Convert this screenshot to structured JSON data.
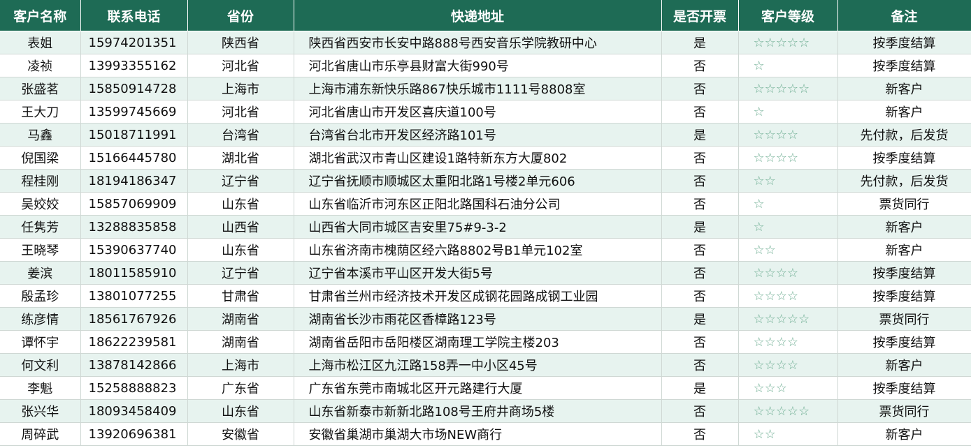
{
  "headers": [
    "客户名称",
    "联系电话",
    "省份",
    "快递地址",
    "是否开票",
    "客户等级",
    "备注"
  ],
  "rows": [
    {
      "name": "表姐",
      "phone": "15974201351",
      "province": "陕西省",
      "address": "陕西省西安市长安中路888号西安音乐学院教研中心",
      "invoice": "是",
      "level": "☆☆☆☆☆",
      "note": "按季度结算"
    },
    {
      "name": "凌祯",
      "phone": "13993355162",
      "province": "河北省",
      "address": "河北省唐山市乐亭县财富大街990号",
      "invoice": "否",
      "level": "☆",
      "note": "按季度结算"
    },
    {
      "name": "张盛茗",
      "phone": "15850914728",
      "province": "上海市",
      "address": "上海市浦东新快乐路867快乐城市1111号8808室",
      "invoice": "否",
      "level": "☆☆☆☆☆",
      "note": "新客户"
    },
    {
      "name": "王大刀",
      "phone": "13599745669",
      "province": "河北省",
      "address": "河北省唐山市开发区喜庆道100号",
      "invoice": "否",
      "level": "☆",
      "note": "新客户"
    },
    {
      "name": "马鑫",
      "phone": "15018711991",
      "province": "台湾省",
      "address": "台湾省台北市开发区经济路101号",
      "invoice": "是",
      "level": "☆☆☆☆",
      "note": "先付款，后发货"
    },
    {
      "name": "倪国梁",
      "phone": "15166445780",
      "province": "湖北省",
      "address": "湖北省武汉市青山区建设1路特新东方大厦802",
      "invoice": "否",
      "level": "☆☆☆☆",
      "note": "按季度结算"
    },
    {
      "name": "程桂刚",
      "phone": "18194186347",
      "province": "辽宁省",
      "address": "辽宁省抚顺市顺城区太重阳北路1号楼2单元606",
      "invoice": "否",
      "level": "☆☆",
      "note": "先付款，后发货"
    },
    {
      "name": "吴姣姣",
      "phone": "15857069909",
      "province": "山东省",
      "address": "山东省临沂市河东区正阳北路国科石油分公司",
      "invoice": "否",
      "level": "☆",
      "note": "票货同行"
    },
    {
      "name": "任隽芳",
      "phone": "13288835858",
      "province": "山西省",
      "address": "山西省大同市城区吉安里75#9-3-2",
      "invoice": "是",
      "level": "☆",
      "note": "新客户"
    },
    {
      "name": "王晓琴",
      "phone": "15390637740",
      "province": "山东省",
      "address": "山东省济南市槐荫区经六路8802号B1单元102室",
      "invoice": "否",
      "level": "☆☆",
      "note": "新客户"
    },
    {
      "name": "姜滨",
      "phone": "18011585910",
      "province": "辽宁省",
      "address": "辽宁省本溪市平山区开发大街5号",
      "invoice": "否",
      "level": "☆☆☆☆",
      "note": "按季度结算"
    },
    {
      "name": "殷孟珍",
      "phone": "13801077255",
      "province": "甘肃省",
      "address": "甘肃省兰州市经济技术开发区成钢花园路成钢工业园",
      "invoice": "否",
      "level": "☆☆☆☆",
      "note": "按季度结算"
    },
    {
      "name": "练彦情",
      "phone": "18561767926",
      "province": "湖南省",
      "address": "湖南省长沙市雨花区香樟路123号",
      "invoice": "是",
      "level": "☆☆☆☆☆",
      "note": "票货同行"
    },
    {
      "name": "谭怀宇",
      "phone": "18622239581",
      "province": "湖南省",
      "address": "湖南省岳阳市岳阳楼区湖南理工学院主楼203",
      "invoice": "否",
      "level": "☆☆☆☆",
      "note": "按季度结算"
    },
    {
      "name": "何文利",
      "phone": "13878142866",
      "province": "上海市",
      "address": "上海市松江区九江路158弄一中小区45号",
      "invoice": "否",
      "level": "☆☆☆☆",
      "note": "新客户"
    },
    {
      "name": "李魁",
      "phone": "15258888823",
      "province": "广东省",
      "address": "广东省东莞市南城北区开元路建行大厦",
      "invoice": "是",
      "level": "☆☆☆",
      "note": "按季度结算"
    },
    {
      "name": "张兴华",
      "phone": "18093458409",
      "province": "山东省",
      "address": "山东省新泰市新新北路108号王府井商场5楼",
      "invoice": "否",
      "level": "☆☆☆☆☆",
      "note": "票货同行"
    },
    {
      "name": "周碎武",
      "phone": "13920696381",
      "province": "安徽省",
      "address": "安徽省巢湖市巢湖大市场NEW商行",
      "invoice": "否",
      "level": "☆☆",
      "note": "新客户"
    }
  ]
}
